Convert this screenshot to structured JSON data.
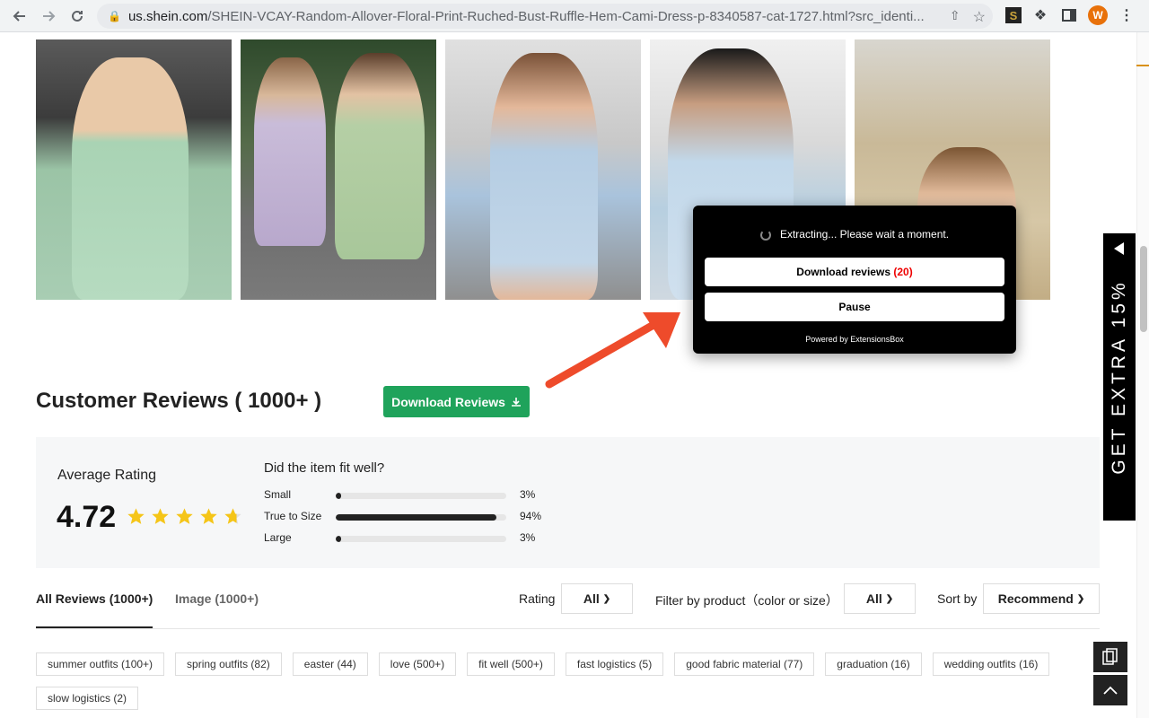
{
  "browser": {
    "url_host": "us.shein.com",
    "url_path": "/SHEIN-VCAY-Random-Allover-Floral-Print-Ruched-Bust-Ruffle-Hem-Cami-Dress-p-8340587-cat-1727.html?src_identi...",
    "avatar_letter": "W"
  },
  "popup": {
    "status": "Extracting... Please wait a moment.",
    "download_label": "Download reviews",
    "download_count": "(20)",
    "pause_label": "Pause",
    "powered_prefix": "Powered by",
    "powered_brand": "ExtensionsBox"
  },
  "reviews": {
    "title": "Customer Reviews ( 1000+ )",
    "download_button": "Download Reviews"
  },
  "rating": {
    "avg_label": "Average Rating",
    "avg_value": "4.72",
    "stars": 4.72,
    "fit_question": "Did the item fit well?",
    "fit": [
      {
        "label": "Small",
        "pct": "3%",
        "value": 0.03
      },
      {
        "label": "True to Size",
        "pct": "94%",
        "value": 0.94
      },
      {
        "label": "Large",
        "pct": "3%",
        "value": 0.03
      }
    ]
  },
  "tabs": {
    "all": "All Reviews (1000+)",
    "image": "Image (1000+)"
  },
  "filters": {
    "rating_label": "Rating",
    "rating_value": "All",
    "product_label": "Filter by product（color or size）",
    "product_value": "All",
    "sort_label": "Sort by",
    "sort_value": "Recommend"
  },
  "tags": [
    "summer outfits (100+)",
    "spring outfits (82)",
    "easter (44)",
    "love (500+)",
    "fit well (500+)",
    "fast logistics (5)",
    "good fabric material (77)",
    "graduation (16)",
    "wedding outfits (16)",
    "slow logistics (2)"
  ],
  "promo": {
    "text": "GET EXTRA 15%"
  },
  "colors": {
    "download_green": "#1fa35b",
    "star_yellow": "#f5c518",
    "arrow_red": "#ee4b2b",
    "count_red": "#e00000"
  }
}
